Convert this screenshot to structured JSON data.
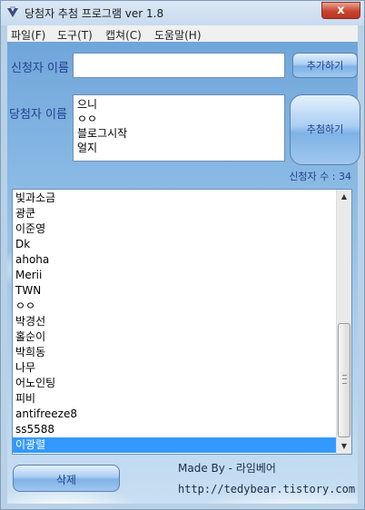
{
  "window": {
    "title": "당첨자 추첨 프로그램 ver 1.8",
    "close_symbol": "x"
  },
  "menu": {
    "items": [
      {
        "label": "파일(F)"
      },
      {
        "label": "도구(T)"
      },
      {
        "label": "캡쳐(C)"
      },
      {
        "label": "도움말(H)"
      }
    ]
  },
  "form": {
    "applicant_label": "신청자 이름",
    "applicant_value": "",
    "add_button": "추가하기",
    "winner_label": "당첨자 이름",
    "winners": [
      "으니",
      "ㅇㅇ",
      "블로그시작",
      "얼지"
    ],
    "draw_button": "추첨하기",
    "count_text": "신청자 수 : 34"
  },
  "applicants": {
    "items": [
      "빛과소금",
      "광쿤",
      "이준영",
      "Dk",
      "ahoha",
      "Merii",
      "TWN",
      "ㅇㅇ",
      "박경선",
      "홀순이",
      "박희동",
      "나무",
      "어노인팅",
      "피비",
      "antifreeze8",
      "ss5588",
      "이광렬"
    ],
    "selected_index": 16
  },
  "footer": {
    "delete_button": "삭제",
    "made_by": "Made By - 라임베어",
    "url": "http://tedybear.tistory.com"
  }
}
